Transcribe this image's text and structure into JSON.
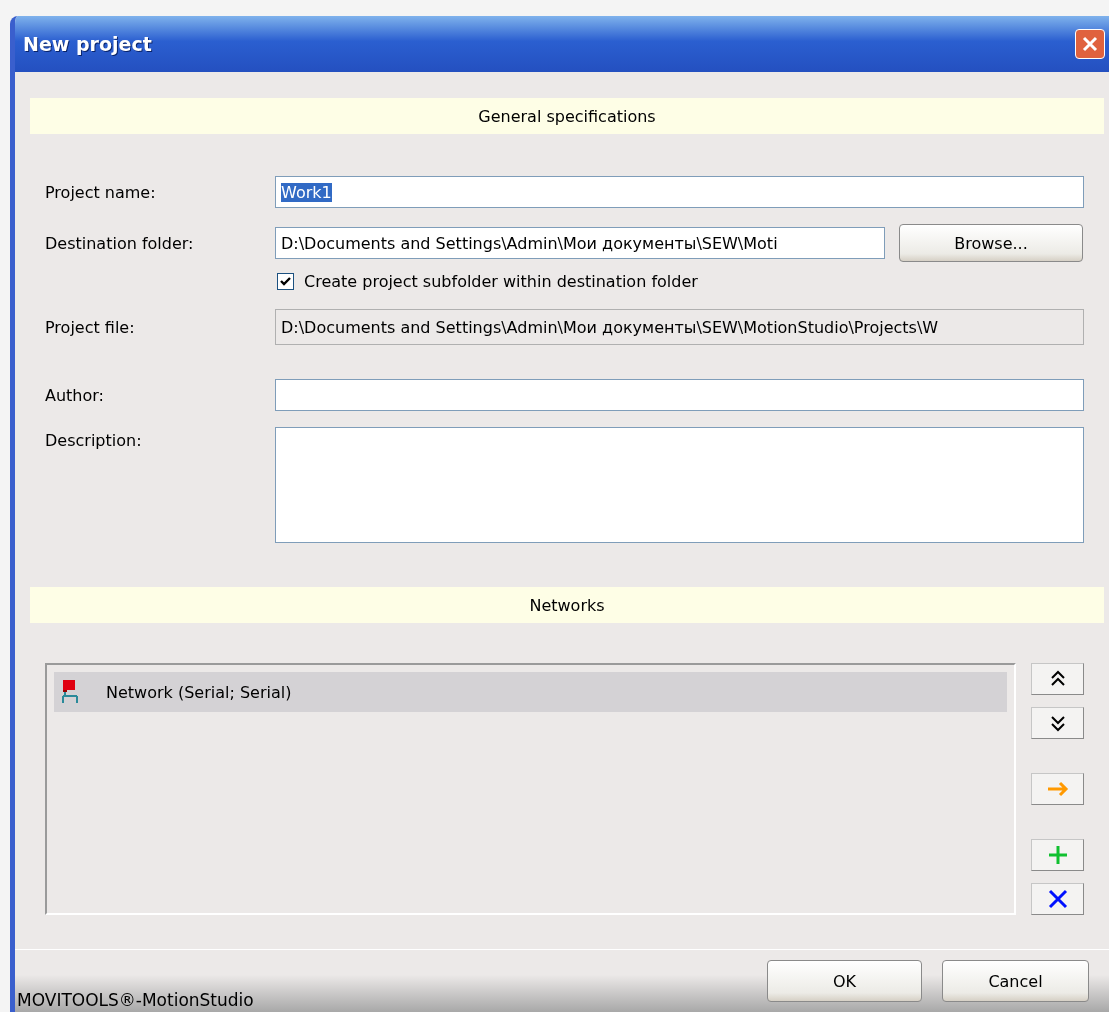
{
  "window": {
    "title": "New project"
  },
  "general": {
    "header": "General specifications",
    "project_name": {
      "label": "Project name:",
      "value": "Work1",
      "text_selected": true
    },
    "destination": {
      "label": "Destination folder:",
      "value": "D:\\Documents and Settings\\Admin\\Мои документы\\SEW\\Moti",
      "button": "Browse..."
    },
    "subfolder": {
      "label": "Create project subfolder within destination folder",
      "checked": true
    },
    "project_file": {
      "label": "Project file:",
      "value": "D:\\Documents and Settings\\Admin\\Мои документы\\SEW\\MotionStudio\\Projects\\W",
      "disabled": true
    },
    "author": {
      "label": "Author:"
    },
    "description": {
      "label": "Description:"
    }
  },
  "networks": {
    "header": "Networks",
    "items": [
      {
        "label": "Network (Serial; Serial)",
        "selected": true
      }
    ]
  },
  "status_bar": "MOVITOOLS®-MotionStudio",
  "buttons": {
    "ok": "OK",
    "cancel": "Cancel"
  }
}
